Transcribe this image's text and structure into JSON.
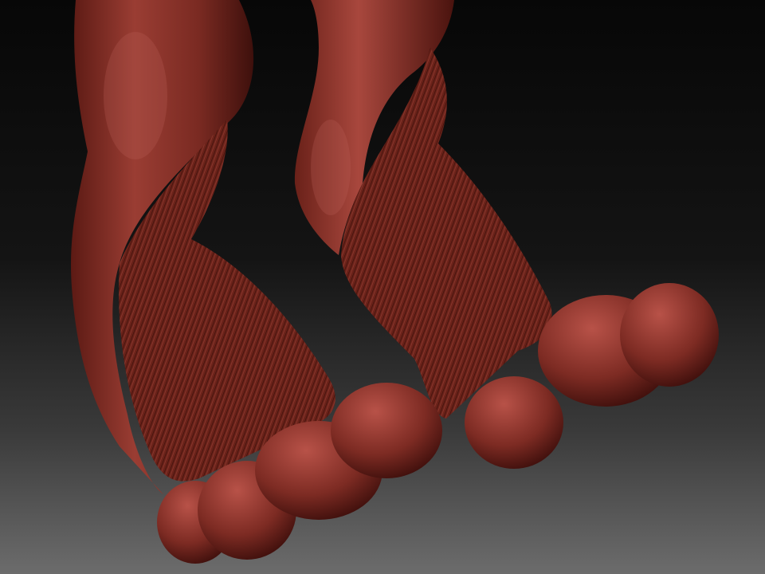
{
  "scene": {
    "subject": "digital-sculpt-creature-legs",
    "material_color": "#7a2a22",
    "material_highlight": "#b5544a",
    "material_shadow": "#3a0d0a",
    "background_top": "#080808",
    "background_bottom": "#6e6e6e"
  }
}
